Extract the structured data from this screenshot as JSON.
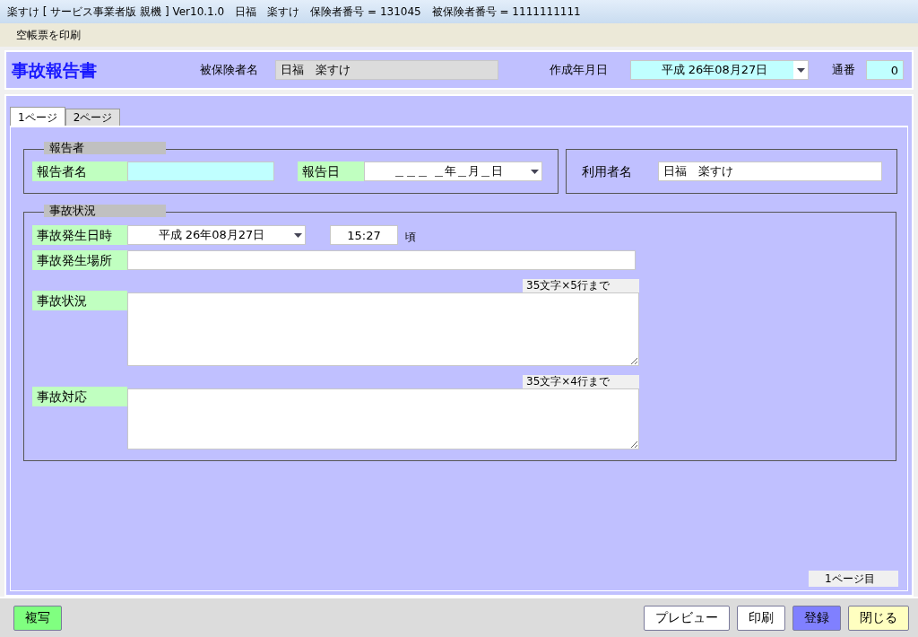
{
  "window": {
    "title": "楽すけ [ サービス事業者版 親機 ] Ver10.1.0　日福　楽すけ　保険者番号 = 131045　被保険者番号 = 1111111111"
  },
  "menu": [
    {
      "label": "空帳票を印刷"
    }
  ],
  "header": {
    "title": "事故報告書",
    "insured_name": {
      "label": "被保険者名",
      "value": "日福　楽すけ"
    },
    "created_date": {
      "label": "作成年月日",
      "value": "平成 26年08月27日"
    },
    "serial": {
      "label": "通番",
      "value": "0"
    }
  },
  "tabs": [
    {
      "label": "1ページ",
      "selected": true
    },
    {
      "label": "2ページ",
      "selected": false
    }
  ],
  "reporter": {
    "title": "報告者",
    "name_label": "報告者名",
    "date_label": "報告日",
    "date_value": "＿＿＿ ＿年＿月＿日"
  },
  "user": {
    "label": "利用者名",
    "value": "日福　楽すけ"
  },
  "accident": {
    "title": "事故状況",
    "datetime_label": "事故発生日時",
    "date_value": "平成 26年08月27日",
    "time_value": "15:27",
    "time_suffix": "頃",
    "place_label": "事故発生場所",
    "situation_label": "事故状況",
    "situation_note": "35文字×5行まで",
    "response_label": "事故対応",
    "response_note": "35文字×4行まで"
  },
  "page_indicator": "1ページ目",
  "left_buttons": [
    {
      "label": "複写",
      "color": "#80ff80"
    }
  ],
  "right_buttons": [
    {
      "label": "プレビュー",
      "color": "#ffffff"
    },
    {
      "label": "印刷",
      "color": "#ffffff"
    },
    {
      "label": "登録",
      "color": "#8080ff"
    },
    {
      "label": "閉じる",
      "color": "#ffffc0"
    }
  ]
}
